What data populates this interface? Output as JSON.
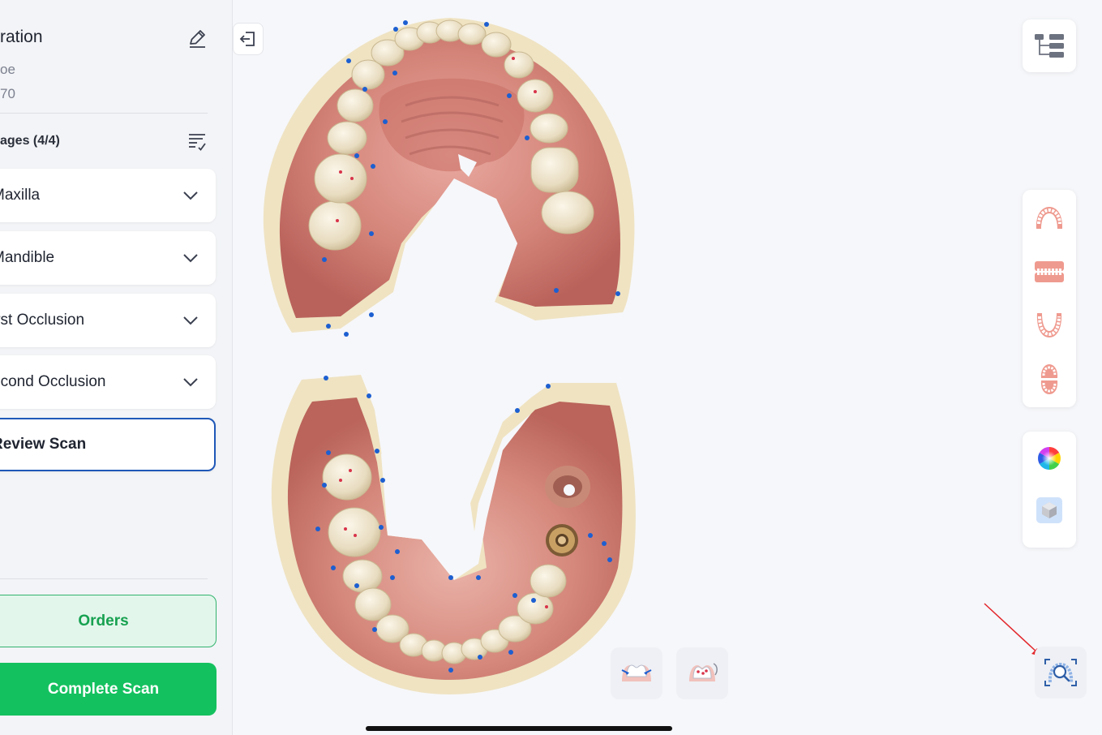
{
  "sidebar": {
    "title": "ration",
    "patient_name": "oe",
    "patient_id": "70",
    "stages_label": "ages (4/4)",
    "stages": [
      {
        "label": "Maxilla"
      },
      {
        "label": "Mandible"
      },
      {
        "label": "irst Occlusion"
      },
      {
        "label": "econd Occlusion"
      }
    ],
    "review_label": "Review Scan",
    "orders_label": "Orders",
    "complete_label": "Complete Scan"
  },
  "icons": {
    "edit": "pencil-icon",
    "stages_list": "list-filter-icon",
    "chevron": "chevron-down-icon",
    "exit": "exit-icon",
    "tree": "tree-hierarchy-icon",
    "upper_jaw": "upper-jaw-icon",
    "both_jaws": "bite-view-icon",
    "lower_jaw": "lower-jaw-icon",
    "upper_open": "open-jaw-icon",
    "color_mode": "color-wheel-icon",
    "mono_mode": "cube-icon",
    "margin_tool": "tooth-margin-icon",
    "marker_tool": "tooth-marker-icon",
    "scan_review": "scan-review-icon"
  },
  "colors": {
    "accent_blue": "#1f58b8",
    "green": "#14c15f",
    "green_light": "#e3f6ec",
    "gum": "#c86e66",
    "tooth": "#ede3c8",
    "marker": "#1d5fd1"
  }
}
